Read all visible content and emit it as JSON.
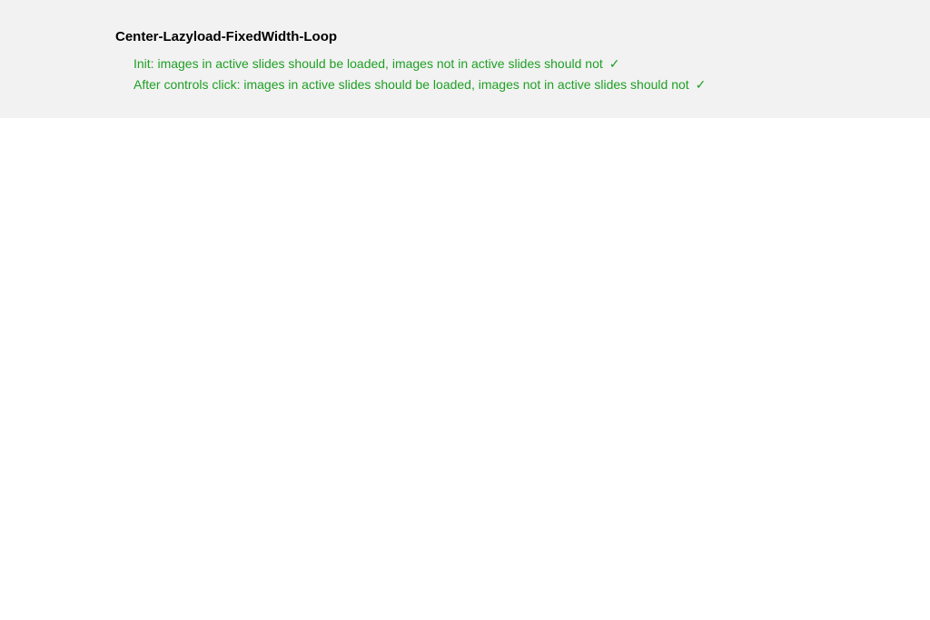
{
  "panel": {
    "title": "Center-Lazyload-FixedWidth-Loop",
    "tests": [
      {
        "text": "Init: images in active slides should be loaded, images not in active slides should not",
        "status_icon": "✓"
      },
      {
        "text": "After controls click: images in active slides should be loaded, images not in active slides should not",
        "status_icon": "✓"
      }
    ]
  }
}
